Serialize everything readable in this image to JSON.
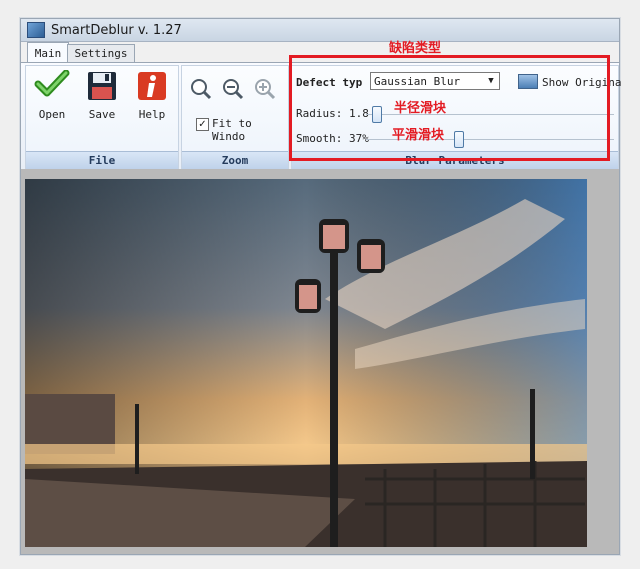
{
  "window": {
    "title": "SmartDeblur v. 1.27"
  },
  "tabs": [
    {
      "label": "Main",
      "active": true
    },
    {
      "label": "Settings",
      "active": false
    }
  ],
  "file_group": {
    "label": "File",
    "buttons": [
      {
        "label": "Open",
        "icon": "open-checkmark-icon"
      },
      {
        "label": "Save",
        "icon": "floppy-disk-icon"
      },
      {
        "label": "Help",
        "icon": "info-icon"
      }
    ]
  },
  "zoom_group": {
    "label": "Zoom",
    "icons": [
      "zoom-fit-icon",
      "zoom-out-icon",
      "zoom-in-icon"
    ],
    "fit_to_window": {
      "label": "Fit to Windo",
      "checked": true
    }
  },
  "blur_group": {
    "label": "Blur Parameters",
    "defect_type_label": "Defect typ",
    "defect_type_value": "Gaussian Blur",
    "show_original_label": "Show Origina",
    "radius": {
      "label": "Radius:",
      "value": "1.8",
      "fraction": 0.04
    },
    "smooth": {
      "label": "Smooth:",
      "value": "37%",
      "fraction": 0.37
    }
  },
  "annotations": {
    "defect_type": "缺陷类型",
    "radius_slider": "半径滑块",
    "smooth_slider": "平滑滑块"
  },
  "colors": {
    "annotation_red": "#e31b23",
    "ribbon_blue": "#bfd2ea"
  }
}
